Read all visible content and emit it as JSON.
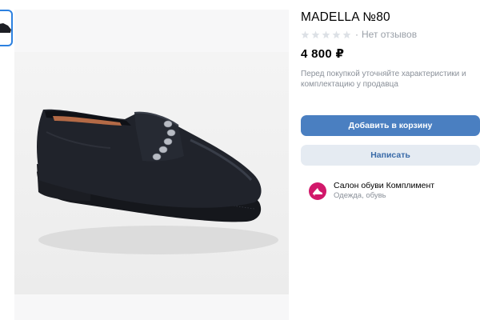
{
  "product": {
    "title": "MADELLA №80",
    "rating": {
      "stars_filled": 0,
      "stars_total": 5,
      "separator": "·",
      "reviews_text": "Нет отзывов"
    },
    "price": "4 800 ₽",
    "notice": "Перед покупкой уточняйте характеристики и комплектацию у продавца"
  },
  "actions": {
    "add_to_cart_label": "Добавить в корзину",
    "message_label": "Написать"
  },
  "seller": {
    "name": "Салон обуви Комплимент",
    "category": "Одежда, обувь"
  },
  "colors": {
    "primary_button": "#4a7fc1",
    "secondary_button": "#e5ebf2",
    "secondary_text": "#3a6ba8",
    "avatar": "#d1186a",
    "thumb_border": "#2d81e0",
    "star_empty": "#dde1e6"
  },
  "icons": {
    "star": "star-icon",
    "seller_avatar": "shoe-logo-icon"
  }
}
